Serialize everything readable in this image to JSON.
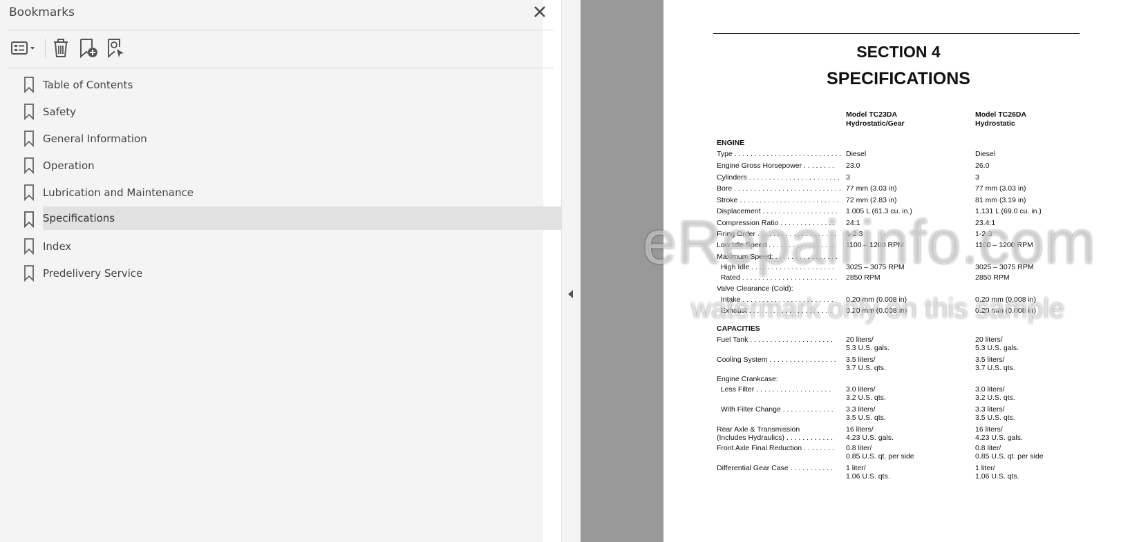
{
  "panel": {
    "title": "Bookmarks",
    "items": [
      {
        "label": "Table of Contents"
      },
      {
        "label": "Safety"
      },
      {
        "label": "General Information"
      },
      {
        "label": "Operation"
      },
      {
        "label": "Lubrication and Maintenance"
      },
      {
        "label": "Specifications",
        "selected": true
      },
      {
        "label": "Index"
      },
      {
        "label": "Predelivery Service"
      }
    ]
  },
  "document": {
    "section": "SECTION 4",
    "title": "SPECIFICATIONS",
    "col1_header": [
      "Model TC23DA",
      "Hydrostatic/Gear"
    ],
    "col2_header": [
      "Model TC26DA",
      "Hydrostatic"
    ],
    "rows": [
      {
        "label": "ENGINE",
        "heading": true
      },
      {
        "label": "Type . . . . . . . . . . . . . . . . . . . . . . . . . . .",
        "v1": "Diesel",
        "v2": "Diesel"
      },
      {
        "label": "Engine Gross Horsepower . . . . . . . .",
        "v1": "23.0",
        "v2": "26.0"
      },
      {
        "label": "Cylinders . . . . . . . . . . . . . . . . . . . . . . .",
        "v1": "3",
        "v2": "3"
      },
      {
        "label": "Bore . . . . . . . . . . . . . . . . . . . . . . . . . . .",
        "v1": "77 mm (3.03 in)",
        "v2": "77 mm (3.03 in)"
      },
      {
        "label": "Stroke . . . . . . . . . . . . . . . . . . . . . . . . .",
        "v1": "72 mm (2.83 in)",
        "v2": "81 mm (3.19 in)"
      },
      {
        "label": "Displacement . . . . . . . . . . . . . . . . . . .",
        "v1": "1.005 L (61.3 cu. in.)",
        "v2": "1.131 L (69.0 cu. in.)"
      },
      {
        "label": "Compression Ratio . . . . . . . . . . . . . .",
        "v1": "24:1",
        "v2": "23.4:1"
      },
      {
        "label": "Firing Order . . . . . . . . . . . . . . . . . . . .",
        "v1": "1-2-3",
        "v2": "1-2-3"
      },
      {
        "label": "Low Idle Speed . . . . . . . . . . . . . . . . .",
        "v1": "1100 – 1200 RPM",
        "v2": "1100 – 1200 RPM"
      },
      {
        "label": "Maximum Speed: . . . . . . . . . . . . . . . ."
      },
      {
        "label": "  High Idle . . . . . . . . . . . . . . . . . . . . .",
        "v1": "3025 – 3075 RPM",
        "v2": "3025 – 3075 RPM"
      },
      {
        "label": "  Rated . . . . . . . . . . . . . . . . . . . . . . . .",
        "v1": "2850 RPM",
        "v2": "2850 RPM"
      },
      {
        "label": "Valve Clearance (Cold):"
      },
      {
        "label": "  Intake . . . . . . . . . . . . . . . . . . . . . . .",
        "v1": "0.20 mm (0.008 in)",
        "v2": "0.20 mm (0.008 in)"
      },
      {
        "label": "  Exhaust . . . . . . . . . . . . . . . . . . . . .",
        "v1": "0.20 mm (0.008 in)",
        "v2": "0.20 mm (0.008 in)"
      },
      {
        "label": "CAPACITIES",
        "heading": true
      },
      {
        "label": "Fuel Tank . . . . . . . . . . . . . . . . . . . . .",
        "v1": "20 liters/",
        "v2": "20 liters/"
      },
      {
        "label": "",
        "v1": "5.3 U.S. gals.",
        "v2": "5.3 U.S. gals."
      },
      {
        "label": "Cooling System . . . . . . . . . . . . . . . . .",
        "v1": "3.5 liters/",
        "v2": "3.5 liters/"
      },
      {
        "label": "",
        "v1": "3.7 U.S. qts.",
        "v2": "3.7 U.S. qts."
      },
      {
        "label": "Engine Crankcase:"
      },
      {
        "label": "  Less Filter . . . . . . . . . . . . . . . . . . .",
        "v1": "3.0 liters/",
        "v2": "3.0 liters/"
      },
      {
        "label": "",
        "v1": "3.2 U.S. qts.",
        "v2": "3.2 U.S. qts."
      },
      {
        "label": "  With Filter Change . . . . . . . . . . . . .",
        "v1": "3.3 liters/",
        "v2": "3.3 liters/"
      },
      {
        "label": "",
        "v1": "3.5 U.S. qts.",
        "v2": "3.5 U.S. qts."
      },
      {
        "label": "Rear Axle & Transmission",
        "v1": "16 liters/",
        "v2": "16 liters/"
      },
      {
        "label": "(Includes Hydraulics) . . . . . . . . . . . .",
        "v1": "4.23 U.S. gals.",
        "v2": "4.23 U.S. gals."
      },
      {
        "label": "Front Axle Final Reduction . . . . . . . .",
        "v1": "0.8 liter/",
        "v2": "0.8 liter/"
      },
      {
        "label": "",
        "v1": "0.85 U.S. qt. per side",
        "v2": "0.85 U.S. qt. per side"
      },
      {
        "label": "Differential Gear Case . . . . . . . . . . .",
        "v1": "1 liter/",
        "v2": "1 liter/"
      },
      {
        "label": "",
        "v1": "1.06 U.S. qts.",
        "v2": "1.06 U.S. qts."
      }
    ]
  },
  "watermark": {
    "line1": "eRepairinfo.com",
    "line2": "watermark only on this sample"
  }
}
